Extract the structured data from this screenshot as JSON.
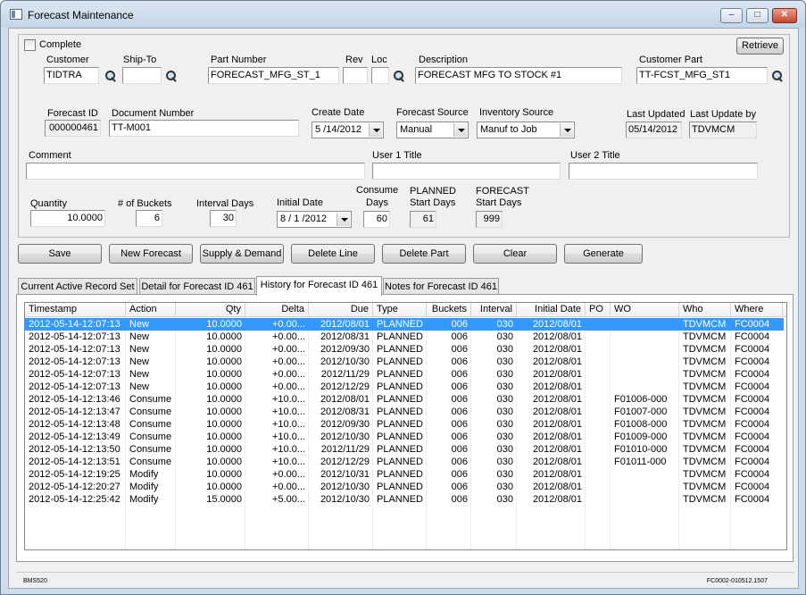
{
  "window": {
    "title": "Forecast Maintenance",
    "min_label": "–",
    "max_label": "□",
    "close_label": "✕"
  },
  "form": {
    "complete_label": "Complete",
    "retrieve_label": "Retrieve",
    "customer": {
      "label": "Customer",
      "value": "TIDTRA"
    },
    "ship_to": {
      "label": "Ship-To",
      "value": ""
    },
    "part_number": {
      "label": "Part Number",
      "value": "FORECAST_MFG_ST_1"
    },
    "rev": {
      "label": "Rev",
      "value": ""
    },
    "loc": {
      "label": "Loc",
      "value": ""
    },
    "description": {
      "label": "Description",
      "value": "FORECAST MFG TO STOCK #1"
    },
    "customer_part": {
      "label": "Customer Part",
      "value": "TT-FCST_MFG_ST1"
    },
    "forecast_id": {
      "label": "Forecast ID",
      "value": "000000461"
    },
    "document_number": {
      "label": "Document Number",
      "value": "TT-M001"
    },
    "create_date": {
      "label": "Create Date",
      "value": "5 /14/2012"
    },
    "forecast_source": {
      "label": "Forecast Source",
      "value": "Manual"
    },
    "inventory_source": {
      "label": "Inventory Source",
      "value": "Manuf to Job"
    },
    "last_updated": {
      "label": "Last Updated",
      "value": "05/14/2012"
    },
    "last_update_by": {
      "label": "Last Update by",
      "value": "TDVMCM"
    },
    "comment": {
      "label": "Comment",
      "value": ""
    },
    "user1_title": {
      "label": "User 1 Title",
      "value": ""
    },
    "user2_title": {
      "label": "User 2 Title",
      "value": ""
    },
    "quantity": {
      "label": "Quantity",
      "value": "10.0000"
    },
    "buckets": {
      "label": "# of Buckets",
      "value": "6"
    },
    "interval_days": {
      "label": "Interval Days",
      "value": "30"
    },
    "initial_date": {
      "label": "Initial Date",
      "value": "8 / 1 /2012"
    },
    "consume_days": {
      "label_1": "Consume",
      "label_2": "Days",
      "value": "60"
    },
    "planned_start": {
      "label_1": "PLANNED",
      "label_2": "Start Days",
      "value": "61"
    },
    "forecast_start": {
      "label_1": "FORECAST",
      "label_2": "Start Days",
      "value": "999"
    }
  },
  "buttons": {
    "save": "Save",
    "new_forecast": "New Forecast",
    "supply_demand": "Supply & Demand",
    "delete_line": "Delete Line",
    "delete_part": "Delete Part",
    "clear": "Clear",
    "generate": "Generate"
  },
  "tabs": [
    {
      "label": "Current Active Record Set"
    },
    {
      "label": "Detail for Forecast ID 461"
    },
    {
      "label": "History for Forecast ID 461"
    },
    {
      "label": "Notes for Forecast ID 461"
    }
  ],
  "grid": {
    "columns": [
      "Timestamp",
      "Action",
      "Qty",
      "Delta",
      "Due",
      "Type",
      "Buckets",
      "Interval",
      "Initial Date",
      "PO",
      "WO",
      "Who",
      "Where"
    ],
    "rows": [
      [
        "2012-05-14-12:07:13",
        "New",
        "10.0000",
        "+0.00...",
        "2012/08/01",
        "PLANNED",
        "006",
        "030",
        "2012/08/01",
        "",
        "",
        "TDVMCM",
        "FC0004"
      ],
      [
        "2012-05-14-12:07:13",
        "New",
        "10.0000",
        "+0.00...",
        "2012/08/31",
        "PLANNED",
        "006",
        "030",
        "2012/08/01",
        "",
        "",
        "TDVMCM",
        "FC0004"
      ],
      [
        "2012-05-14-12:07:13",
        "New",
        "10.0000",
        "+0.00...",
        "2012/09/30",
        "PLANNED",
        "006",
        "030",
        "2012/08/01",
        "",
        "",
        "TDVMCM",
        "FC0004"
      ],
      [
        "2012-05-14-12:07:13",
        "New",
        "10.0000",
        "+0.00...",
        "2012/10/30",
        "PLANNED",
        "006",
        "030",
        "2012/08/01",
        "",
        "",
        "TDVMCM",
        "FC0004"
      ],
      [
        "2012-05-14-12:07:13",
        "New",
        "10.0000",
        "+0.00...",
        "2012/11/29",
        "PLANNED",
        "006",
        "030",
        "2012/08/01",
        "",
        "",
        "TDVMCM",
        "FC0004"
      ],
      [
        "2012-05-14-12:07:13",
        "New",
        "10.0000",
        "+0.00...",
        "2012/12/29",
        "PLANNED",
        "006",
        "030",
        "2012/08/01",
        "",
        "",
        "TDVMCM",
        "FC0004"
      ],
      [
        "2012-05-14-12:13:46",
        "Consume",
        "10.0000",
        "+10.0...",
        "2012/08/01",
        "PLANNED",
        "006",
        "030",
        "2012/08/01",
        "",
        "F01006-000",
        "TDVMCM",
        "FC0004"
      ],
      [
        "2012-05-14-12:13:47",
        "Consume",
        "10.0000",
        "+10.0...",
        "2012/08/31",
        "PLANNED",
        "006",
        "030",
        "2012/08/01",
        "",
        "F01007-000",
        "TDVMCM",
        "FC0004"
      ],
      [
        "2012-05-14-12:13:48",
        "Consume",
        "10.0000",
        "+10.0...",
        "2012/09/30",
        "PLANNED",
        "006",
        "030",
        "2012/08/01",
        "",
        "F01008-000",
        "TDVMCM",
        "FC0004"
      ],
      [
        "2012-05-14-12:13:49",
        "Consume",
        "10.0000",
        "+10.0...",
        "2012/10/30",
        "PLANNED",
        "006",
        "030",
        "2012/08/01",
        "",
        "F01009-000",
        "TDVMCM",
        "FC0004"
      ],
      [
        "2012-05-14-12:13:50",
        "Consume",
        "10.0000",
        "+10.0...",
        "2012/11/29",
        "PLANNED",
        "006",
        "030",
        "2012/08/01",
        "",
        "F01010-000",
        "TDVMCM",
        "FC0004"
      ],
      [
        "2012-05-14-12:13:51",
        "Consume",
        "10.0000",
        "+10.0...",
        "2012/12/29",
        "PLANNED",
        "006",
        "030",
        "2012/08/01",
        "",
        "F01011-000",
        "TDVMCM",
        "FC0004"
      ],
      [
        "2012-05-14-12:19:25",
        "Modify",
        "10.0000",
        "+0.00...",
        "2012/10/31",
        "PLANNED",
        "006",
        "030",
        "2012/08/01",
        "",
        "",
        "TDVMCM",
        "FC0004"
      ],
      [
        "2012-05-14-12:20:27",
        "Modify",
        "10.0000",
        "+0.00...",
        "2012/10/30",
        "PLANNED",
        "006",
        "030",
        "2012/08/01",
        "",
        "",
        "TDVMCM",
        "FC0004"
      ],
      [
        "2012-05-14-12:25:42",
        "Modify",
        "15.0000",
        "+5.00...",
        "2012/10/30",
        "PLANNED",
        "006",
        "030",
        "2012/08/01",
        "",
        "",
        "TDVMCM",
        "FC0004"
      ]
    ]
  },
  "status": {
    "left": "BMS520",
    "right": "FC0002-010512.1507"
  },
  "colors": {
    "selection": "#3399ff",
    "window_frame": "#cfdcea"
  }
}
